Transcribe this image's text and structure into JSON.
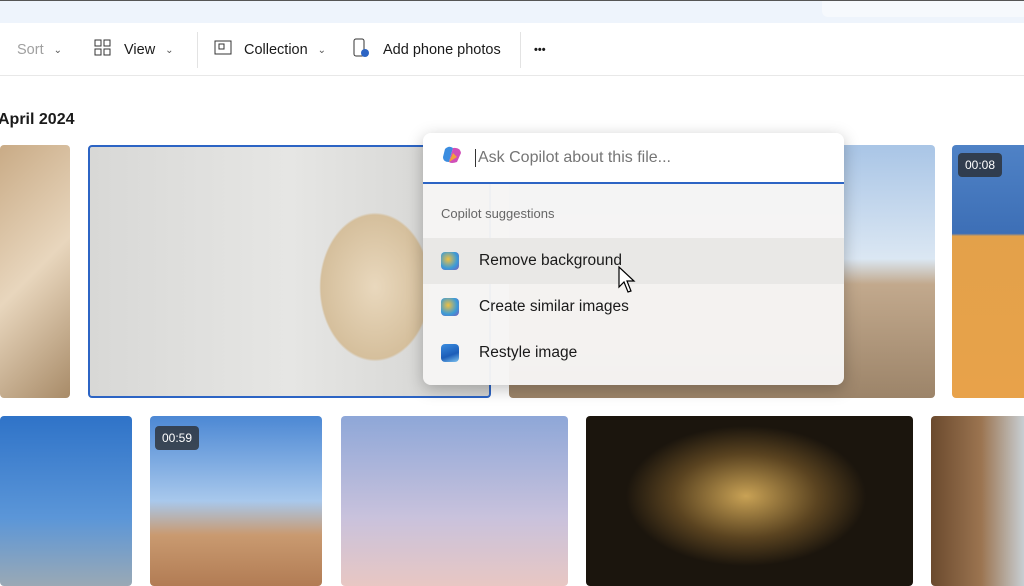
{
  "toolbar": {
    "sort": "Sort",
    "view": "View",
    "collection": "Collection",
    "add_phone": "Add phone photos",
    "more": "•••"
  },
  "section": {
    "heading": "April 2024"
  },
  "tiles": {
    "row1_4_duration": "00:08",
    "row2_2_duration": "00:59"
  },
  "copilot": {
    "placeholder": "Ask Copilot about this file...",
    "suggestions_label": "Copilot suggestions",
    "items": [
      {
        "label": "Remove background",
        "icon": "palette-icon"
      },
      {
        "label": "Create similar images",
        "icon": "palette-icon"
      },
      {
        "label": "Restyle image",
        "icon": "image-icon"
      }
    ]
  },
  "colors": {
    "accent": "#2c64c4"
  }
}
